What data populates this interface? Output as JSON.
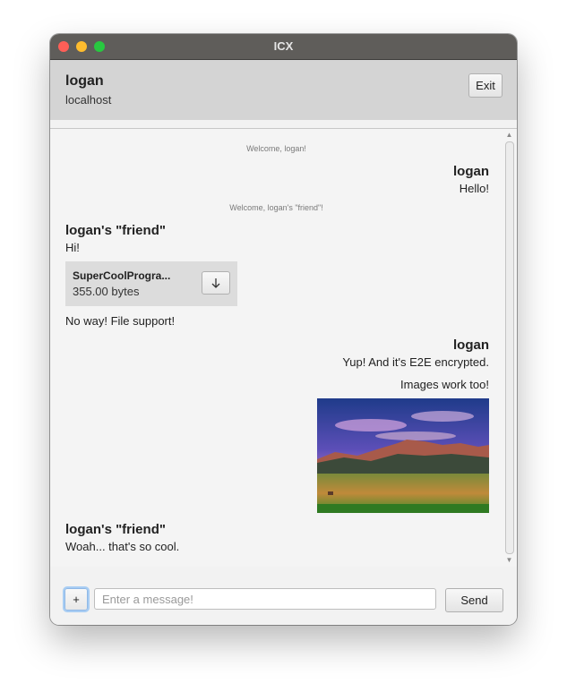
{
  "window": {
    "title": "ICX"
  },
  "header": {
    "username": "logan",
    "host": "localhost",
    "exit_label": "Exit"
  },
  "chat": {
    "system_1": "Welcome, logan!",
    "msg_1": {
      "sender": "logan",
      "text": "Hello!"
    },
    "system_2": "Welcome, logan's \"friend\"!",
    "msg_2": {
      "sender": "logan's \"friend\"",
      "text": "Hi!"
    },
    "file": {
      "name": "SuperCoolProgra...",
      "size": "355.00 bytes",
      "download_icon": "arrow-down-icon"
    },
    "msg_3": {
      "text": "No way! File support!"
    },
    "msg_4": {
      "sender": "logan",
      "text": "Yup! And it's E2E encrypted."
    },
    "msg_5": {
      "text": "Images work too!"
    },
    "image": {
      "subject": "mountain-landscape"
    },
    "msg_6": {
      "sender": "logan's \"friend\"",
      "text": "Woah... that's so cool."
    }
  },
  "footer": {
    "attach_label": "+",
    "input_value": "",
    "input_placeholder": "Enter a message!",
    "send_label": "Send"
  },
  "colors": {
    "titlebar": "#5f5d5a",
    "header_bg": "#d4d4d4",
    "chat_bg": "#f4f4f4",
    "focus_ring": "#a8cdf3"
  }
}
